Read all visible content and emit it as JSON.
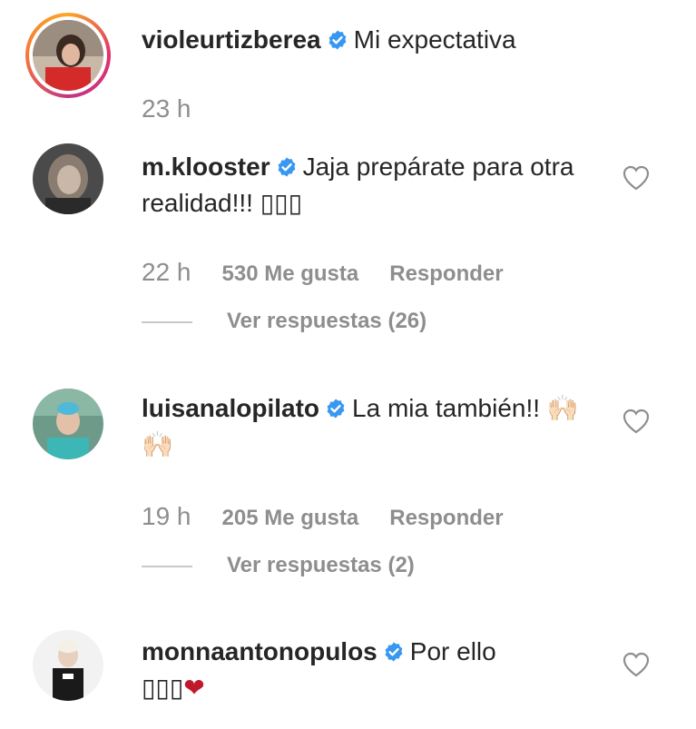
{
  "comments": [
    {
      "username": "violeurtizberea",
      "text": "Mi expectativa",
      "time": "23 h",
      "avatar_icon": "user-avatar-photo",
      "has_story_ring": true
    },
    {
      "username": "m.klooster",
      "text": "Jaja prepárate para otra realidad!!! ",
      "emoji_fallback": "▯▯▯",
      "time": "22 h",
      "likes": "530 Me gusta",
      "reply": "Responder",
      "view_replies": "Ver respuestas (26)",
      "avatar_icon": "user-avatar-photo"
    },
    {
      "username": "luisanalopilato",
      "text": "La mia también!! ",
      "emoji": "🙌🏻🙌🏻",
      "time": "19 h",
      "likes": "205 Me gusta",
      "reply": "Responder",
      "view_replies": "Ver respuestas (2)",
      "avatar_icon": "user-avatar-photo"
    },
    {
      "username": "monnaantonopulos",
      "text": "Por ello",
      "emoji_fallback": "▯▯▯",
      "emoji_heart": "❤",
      "avatar_icon": "user-avatar-photo"
    }
  ],
  "colors": {
    "verified_blue": "#3897f0",
    "meta_gray": "#8e8e8e",
    "heart_red": "#c0192c"
  }
}
